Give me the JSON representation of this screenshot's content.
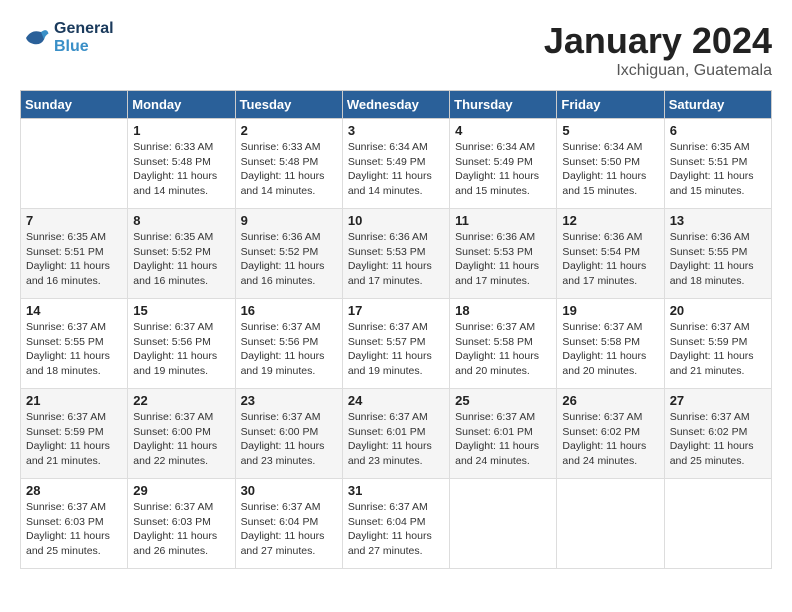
{
  "header": {
    "logo_line1": "General",
    "logo_line2": "Blue",
    "month": "January 2024",
    "location": "Ixchiguan, Guatemala"
  },
  "days_of_week": [
    "Sunday",
    "Monday",
    "Tuesday",
    "Wednesday",
    "Thursday",
    "Friday",
    "Saturday"
  ],
  "weeks": [
    [
      {
        "num": "",
        "info": ""
      },
      {
        "num": "1",
        "info": "Sunrise: 6:33 AM\nSunset: 5:48 PM\nDaylight: 11 hours\nand 14 minutes."
      },
      {
        "num": "2",
        "info": "Sunrise: 6:33 AM\nSunset: 5:48 PM\nDaylight: 11 hours\nand 14 minutes."
      },
      {
        "num": "3",
        "info": "Sunrise: 6:34 AM\nSunset: 5:49 PM\nDaylight: 11 hours\nand 14 minutes."
      },
      {
        "num": "4",
        "info": "Sunrise: 6:34 AM\nSunset: 5:49 PM\nDaylight: 11 hours\nand 15 minutes."
      },
      {
        "num": "5",
        "info": "Sunrise: 6:34 AM\nSunset: 5:50 PM\nDaylight: 11 hours\nand 15 minutes."
      },
      {
        "num": "6",
        "info": "Sunrise: 6:35 AM\nSunset: 5:51 PM\nDaylight: 11 hours\nand 15 minutes."
      }
    ],
    [
      {
        "num": "7",
        "info": "Sunrise: 6:35 AM\nSunset: 5:51 PM\nDaylight: 11 hours\nand 16 minutes."
      },
      {
        "num": "8",
        "info": "Sunrise: 6:35 AM\nSunset: 5:52 PM\nDaylight: 11 hours\nand 16 minutes."
      },
      {
        "num": "9",
        "info": "Sunrise: 6:36 AM\nSunset: 5:52 PM\nDaylight: 11 hours\nand 16 minutes."
      },
      {
        "num": "10",
        "info": "Sunrise: 6:36 AM\nSunset: 5:53 PM\nDaylight: 11 hours\nand 17 minutes."
      },
      {
        "num": "11",
        "info": "Sunrise: 6:36 AM\nSunset: 5:53 PM\nDaylight: 11 hours\nand 17 minutes."
      },
      {
        "num": "12",
        "info": "Sunrise: 6:36 AM\nSunset: 5:54 PM\nDaylight: 11 hours\nand 17 minutes."
      },
      {
        "num": "13",
        "info": "Sunrise: 6:36 AM\nSunset: 5:55 PM\nDaylight: 11 hours\nand 18 minutes."
      }
    ],
    [
      {
        "num": "14",
        "info": "Sunrise: 6:37 AM\nSunset: 5:55 PM\nDaylight: 11 hours\nand 18 minutes."
      },
      {
        "num": "15",
        "info": "Sunrise: 6:37 AM\nSunset: 5:56 PM\nDaylight: 11 hours\nand 19 minutes."
      },
      {
        "num": "16",
        "info": "Sunrise: 6:37 AM\nSunset: 5:56 PM\nDaylight: 11 hours\nand 19 minutes."
      },
      {
        "num": "17",
        "info": "Sunrise: 6:37 AM\nSunset: 5:57 PM\nDaylight: 11 hours\nand 19 minutes."
      },
      {
        "num": "18",
        "info": "Sunrise: 6:37 AM\nSunset: 5:58 PM\nDaylight: 11 hours\nand 20 minutes."
      },
      {
        "num": "19",
        "info": "Sunrise: 6:37 AM\nSunset: 5:58 PM\nDaylight: 11 hours\nand 20 minutes."
      },
      {
        "num": "20",
        "info": "Sunrise: 6:37 AM\nSunset: 5:59 PM\nDaylight: 11 hours\nand 21 minutes."
      }
    ],
    [
      {
        "num": "21",
        "info": "Sunrise: 6:37 AM\nSunset: 5:59 PM\nDaylight: 11 hours\nand 21 minutes."
      },
      {
        "num": "22",
        "info": "Sunrise: 6:37 AM\nSunset: 6:00 PM\nDaylight: 11 hours\nand 22 minutes."
      },
      {
        "num": "23",
        "info": "Sunrise: 6:37 AM\nSunset: 6:00 PM\nDaylight: 11 hours\nand 23 minutes."
      },
      {
        "num": "24",
        "info": "Sunrise: 6:37 AM\nSunset: 6:01 PM\nDaylight: 11 hours\nand 23 minutes."
      },
      {
        "num": "25",
        "info": "Sunrise: 6:37 AM\nSunset: 6:01 PM\nDaylight: 11 hours\nand 24 minutes."
      },
      {
        "num": "26",
        "info": "Sunrise: 6:37 AM\nSunset: 6:02 PM\nDaylight: 11 hours\nand 24 minutes."
      },
      {
        "num": "27",
        "info": "Sunrise: 6:37 AM\nSunset: 6:02 PM\nDaylight: 11 hours\nand 25 minutes."
      }
    ],
    [
      {
        "num": "28",
        "info": "Sunrise: 6:37 AM\nSunset: 6:03 PM\nDaylight: 11 hours\nand 25 minutes."
      },
      {
        "num": "29",
        "info": "Sunrise: 6:37 AM\nSunset: 6:03 PM\nDaylight: 11 hours\nand 26 minutes."
      },
      {
        "num": "30",
        "info": "Sunrise: 6:37 AM\nSunset: 6:04 PM\nDaylight: 11 hours\nand 27 minutes."
      },
      {
        "num": "31",
        "info": "Sunrise: 6:37 AM\nSunset: 6:04 PM\nDaylight: 11 hours\nand 27 minutes."
      },
      {
        "num": "",
        "info": ""
      },
      {
        "num": "",
        "info": ""
      },
      {
        "num": "",
        "info": ""
      }
    ]
  ]
}
